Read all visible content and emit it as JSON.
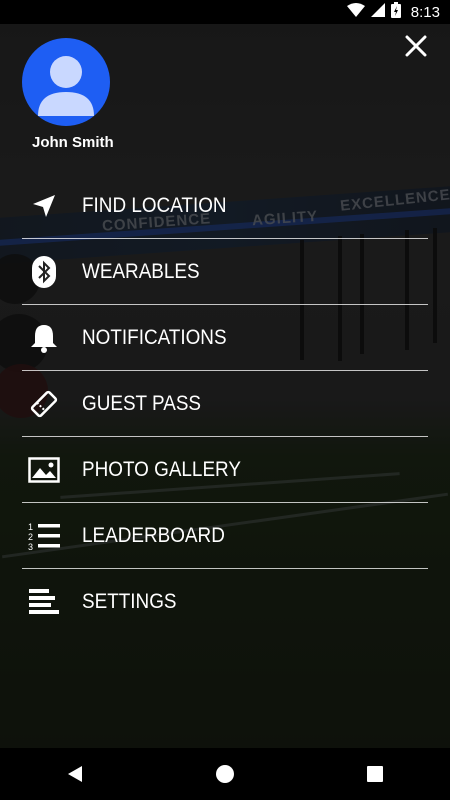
{
  "status_bar": {
    "time": "8:13",
    "icons": [
      "wifi-icon",
      "signal-icon",
      "battery-charging-icon"
    ]
  },
  "close_icon": "close-icon",
  "profile": {
    "name": "John Smith",
    "avatar_color": "#1e5ef3",
    "avatar_icon": "user-avatar-icon"
  },
  "background": {
    "wall_words": [
      "CONFIDENCE",
      "AGILITY",
      "EXCELLENCE"
    ]
  },
  "menu": {
    "items": [
      {
        "label": "FIND LOCATION",
        "icon": "location-arrow-icon"
      },
      {
        "label": "WEARABLES",
        "icon": "bluetooth-icon"
      },
      {
        "label": "NOTIFICATIONS",
        "icon": "bell-icon"
      },
      {
        "label": "GUEST PASS",
        "icon": "ticket-icon"
      },
      {
        "label": "PHOTO GALLERY",
        "icon": "image-icon"
      },
      {
        "label": "LEADERBOARD",
        "icon": "numbered-list-icon"
      },
      {
        "label": "SETTINGS",
        "icon": "settings-lines-icon"
      }
    ]
  },
  "nav_bar": {
    "buttons": [
      "back-icon",
      "home-icon",
      "recents-icon"
    ]
  }
}
